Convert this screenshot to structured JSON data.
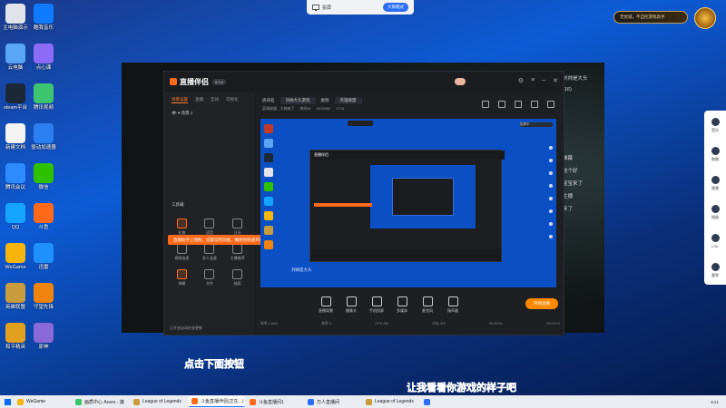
{
  "desktop": {
    "icons": [
      {
        "label": "主电脑演示",
        "color": "#e0e4ea"
      },
      {
        "label": "酷我音乐",
        "color": "#0f7bff"
      },
      {
        "label": "云电脑",
        "color": "#5aa6f6"
      },
      {
        "label": "点心课",
        "color": "#8c6cf6"
      },
      {
        "label": "steam平台",
        "color": "#1b2838"
      },
      {
        "label": "腾讯视频",
        "color": "#3cc46e"
      },
      {
        "label": "新建文档",
        "color": "#f3f3f3"
      },
      {
        "label": "驱动加速器",
        "color": "#2c7ff0"
      },
      {
        "label": "腾讯会议",
        "color": "#2d8bff"
      },
      {
        "label": "微信",
        "color": "#2dc100"
      },
      {
        "label": "QQ",
        "color": "#14a3ff"
      },
      {
        "label": "斗鱼",
        "color": "#ff6a1a"
      },
      {
        "label": "WeGame",
        "color": "#f5b50c"
      },
      {
        "label": "迅雷",
        "color": "#1e90ff"
      },
      {
        "label": "英雄联盟",
        "color": "#c89b3c"
      },
      {
        "label": "守望先锋",
        "color": "#f0840f"
      },
      {
        "label": "和平精英",
        "color": "#e2a020"
      },
      {
        "label": "原神",
        "color": "#8a6ad8"
      }
    ]
  },
  "topbar": {
    "label": "投屏",
    "button": "大屏模式"
  },
  "promo": {
    "text": "无忧城，不自控游戏高手"
  },
  "right_sidebar": {
    "items": [
      "音乐",
      "购物",
      "视频",
      "相册",
      "LOL",
      "更多"
    ]
  },
  "chat_overlay": {
    "lines": [
      "刘帅是大头",
      "(16)",
      "弹幕",
      "这个好",
      "宝宝来了",
      "主播",
      "来了"
    ]
  },
  "app": {
    "logo": "直播伴侣",
    "version": "8.9.6",
    "tabs": [
      "场景设置",
      "直播",
      "互动",
      "可视化"
    ],
    "scene_name": "场景 1",
    "room": {
      "label": "房间名",
      "room_name": "刘帅大头游戏",
      "category": "类别",
      "category_value": "英雄联盟",
      "room_id_label": "房间ID",
      "room_id": "6319952",
      "fans": "1724",
      "tag": "英雄联盟 - 大神来了"
    },
    "toolbox_title": "工具箱",
    "tools": [
      "礼物",
      "语音",
      "日历",
      "视频连麦",
      "多人连麦",
      "主播推荐",
      "弹幕",
      "文件",
      "抽奖"
    ],
    "notice": "直播助手上线啦，设置常用功能，确保你快速开播",
    "bottom_hint": "已开启自动检查更新",
    "preview": {
      "badge": "投屏中",
      "label": "刘帅是大头"
    },
    "bottom_tools": [
      "直播背景",
      "摄像头",
      "手机投屏",
      "多媒体",
      "麦克风",
      "扬声器"
    ],
    "start_button": "开始直播",
    "stats": {
      "bitrate": "码率 0 kb/s",
      "fps": "帧率 0",
      "cpu": "CPU 8%",
      "mem": "内存 3%",
      "duration": "00:00:00",
      "time": "00:06:12"
    }
  },
  "subtitles": {
    "line1": "点击下面按钮",
    "line2": "让我看看你游戏的样子吧"
  },
  "taskbar": {
    "tasks": [
      {
        "label": "WeGame",
        "color": "#f5b50c"
      },
      {
        "label": "画质中心 Acero - 旗",
        "color": "#3cc46e"
      },
      {
        "label": "League of Legends",
        "color": "#c89b3c"
      },
      {
        "label": "斗鱼直播伴侣(正在...)",
        "color": "#ff6a1a"
      },
      {
        "label": "斗鱼直播间1",
        "color": "#ff6a1a"
      },
      {
        "label": "万人直播间",
        "color": "#2b6ef5"
      },
      {
        "label": "League of Legends",
        "color": "#c89b3c"
      },
      {
        "label": "",
        "color": "#2b6ef5"
      }
    ],
    "time": "9:21"
  }
}
